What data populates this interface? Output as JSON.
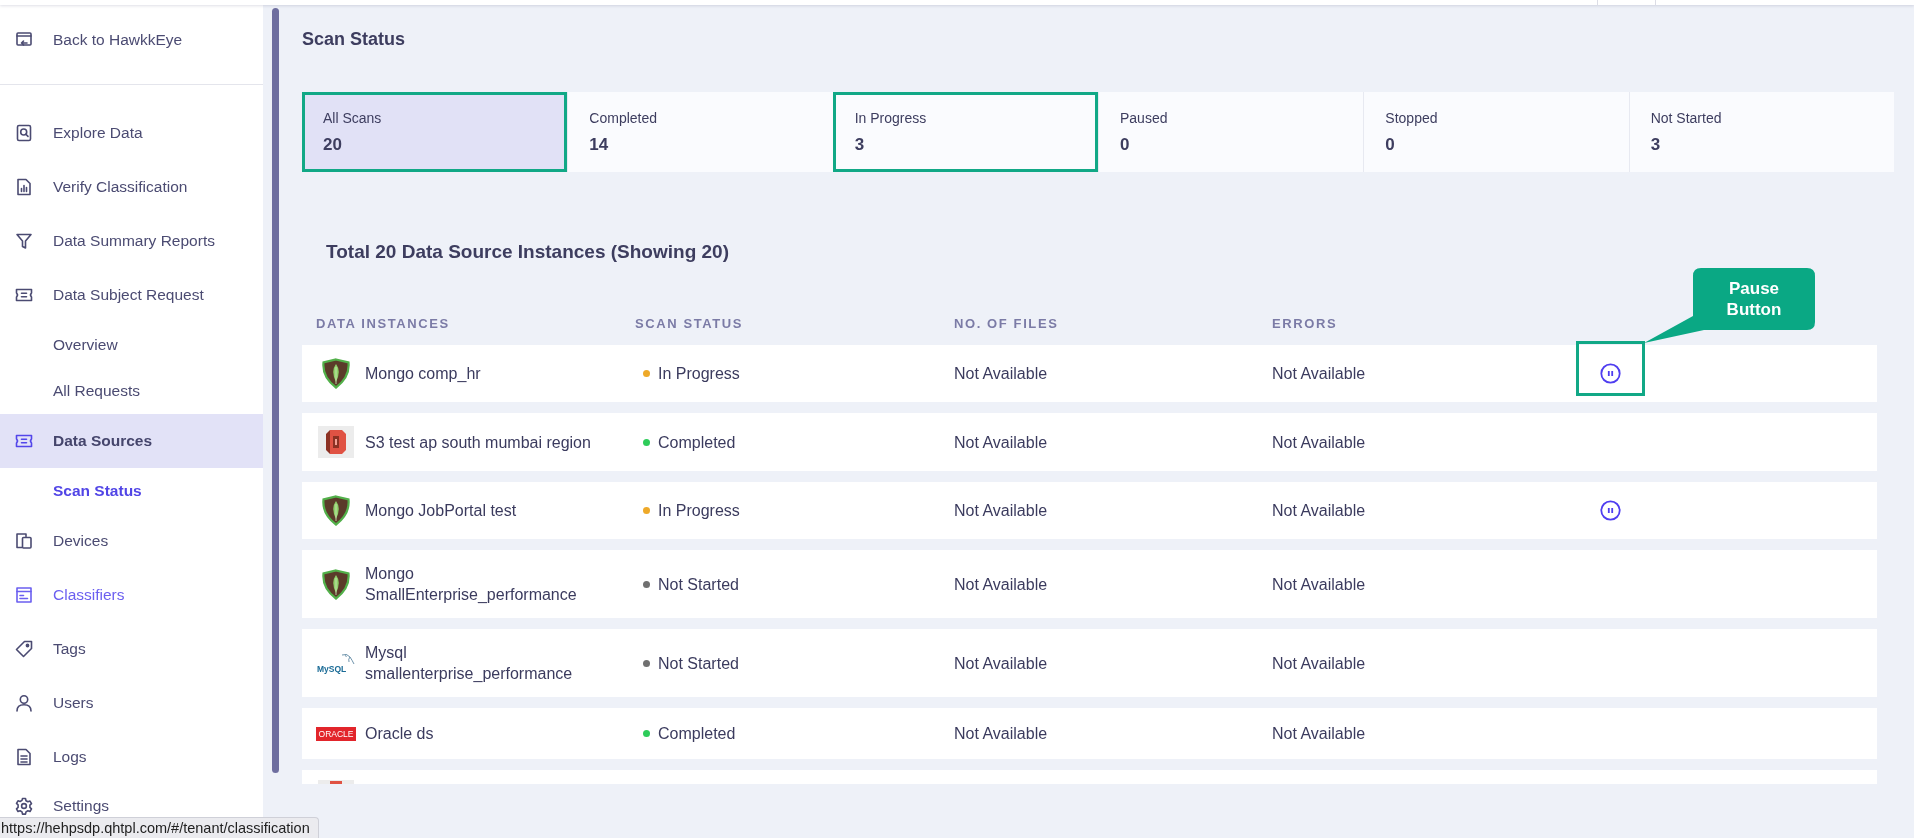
{
  "sidebar": {
    "back_link": "Back to HawkkEye",
    "items": [
      {
        "label": "Explore Data",
        "selected": false,
        "hovered": false
      },
      {
        "label": "Verify Classification",
        "selected": false,
        "hovered": false
      },
      {
        "label": "Data Summary Reports",
        "selected": false,
        "hovered": false
      },
      {
        "label": "Data Subject Request",
        "selected": false,
        "hovered": false,
        "children": [
          {
            "label": "Overview",
            "selected": false
          },
          {
            "label": "All Requests",
            "selected": false
          }
        ]
      },
      {
        "label": "Data Sources",
        "selected": true,
        "hovered": false,
        "children": [
          {
            "label": "Scan Status",
            "selected": true
          }
        ]
      },
      {
        "label": "Devices",
        "selected": false,
        "hovered": false
      },
      {
        "label": "Classifiers",
        "selected": false,
        "hovered": true
      },
      {
        "label": "Tags",
        "selected": false,
        "hovered": false
      },
      {
        "label": "Users",
        "selected": false,
        "hovered": false
      },
      {
        "label": "Logs",
        "selected": false,
        "hovered": false
      },
      {
        "label": "Settings",
        "selected": false,
        "hovered": false
      }
    ]
  },
  "page_title": "Scan Status",
  "summary_cards": [
    {
      "label": "All Scans",
      "value": "20",
      "selected": true,
      "highlighted": true
    },
    {
      "label": "Completed",
      "value": "14",
      "selected": false,
      "highlighted": false
    },
    {
      "label": "In Progress",
      "value": "3",
      "selected": false,
      "highlighted": true
    },
    {
      "label": "Paused",
      "value": "0",
      "selected": false,
      "highlighted": false
    },
    {
      "label": "Stopped",
      "value": "0",
      "selected": false,
      "highlighted": false
    },
    {
      "label": "Not Started",
      "value": "3",
      "selected": false,
      "highlighted": false
    }
  ],
  "table": {
    "title": "Total 20 Data Source Instances (Showing 20)",
    "columns": [
      "DATA INSTANCES",
      "SCAN STATUS",
      "NO. OF FILES",
      "ERRORS"
    ],
    "rows": [
      {
        "kind": "mongo",
        "name": "Mongo comp_hr",
        "status": {
          "label": "In Progress",
          "color": "#eea929"
        },
        "files": "Not Available",
        "errors": "Not Available",
        "pause_button": true,
        "pause_highlighted": true
      },
      {
        "kind": "s3",
        "name": "S3 test ap south mumbai region",
        "status": {
          "label": "Completed",
          "color": "#2ecc5a"
        },
        "files": "Not Available",
        "errors": "Not Available",
        "pause_button": false,
        "pause_highlighted": false
      },
      {
        "kind": "mongo",
        "name": "Mongo JobPortal test",
        "status": {
          "label": "In Progress",
          "color": "#eea929"
        },
        "files": "Not Available",
        "errors": "Not Available",
        "pause_button": true,
        "pause_highlighted": false
      },
      {
        "kind": "mongo",
        "name": "Mongo SmallEnterprise_performance",
        "status": {
          "label": "Not Started",
          "color": "#707070"
        },
        "files": "Not Available",
        "errors": "Not Available",
        "pause_button": false,
        "pause_highlighted": false
      },
      {
        "kind": "mysql",
        "logo_text": "MySQL",
        "name": "Mysql smallenterprise_performance",
        "status": {
          "label": "Not Started",
          "color": "#707070"
        },
        "files": "Not Available",
        "errors": "Not Available",
        "pause_button": false,
        "pause_highlighted": false
      },
      {
        "kind": "oracle",
        "logo_text": "ORACLE",
        "name": "Oracle ds",
        "status": {
          "label": "Completed",
          "color": "#2ecc5a"
        },
        "files": "Not Available",
        "errors": "Not Available",
        "pause_button": false,
        "pause_highlighted": false
      }
    ],
    "partial_row": {
      "kind": "s3"
    }
  },
  "annotation": {
    "text": "Pause Button"
  },
  "status_bar": {
    "url": "https://hehpsdp.qhtpl.com/#/tenant/classification"
  }
}
